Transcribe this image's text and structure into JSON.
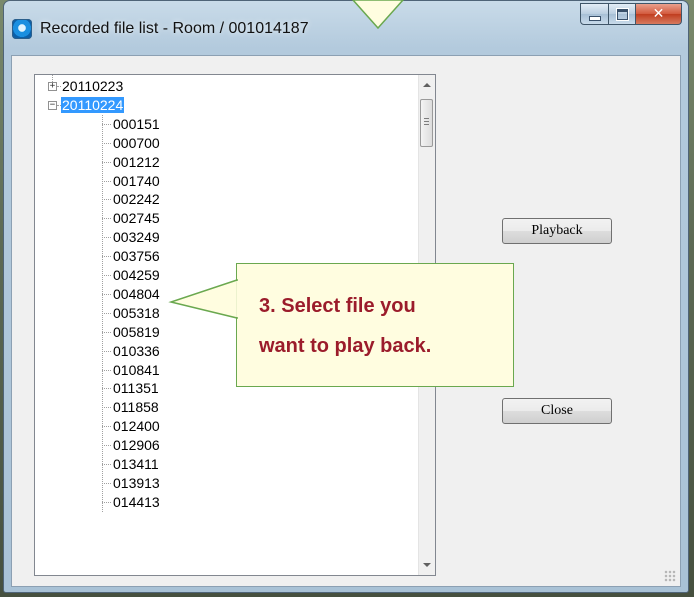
{
  "window": {
    "title": "Recorded file list - Room / 001014187"
  },
  "tree": {
    "collapsed_date": "20110223",
    "expanded_date": "20110224",
    "files": [
      "000151",
      "000700",
      "001212",
      "001740",
      "002242",
      "002745",
      "003249",
      "003756",
      "004259",
      "004804",
      "005318",
      "005819",
      "010336",
      "010841",
      "011351",
      "011858",
      "012400",
      "012906",
      "013411",
      "013913",
      "014413"
    ]
  },
  "buttons": {
    "playback": "Playback",
    "close": "Close"
  },
  "callout": {
    "text": "3. Select file you\nwant to play back."
  },
  "colors": {
    "selection": "#3399ff",
    "callout_text": "#9b1c2b",
    "callout_border": "#6aa84f"
  }
}
